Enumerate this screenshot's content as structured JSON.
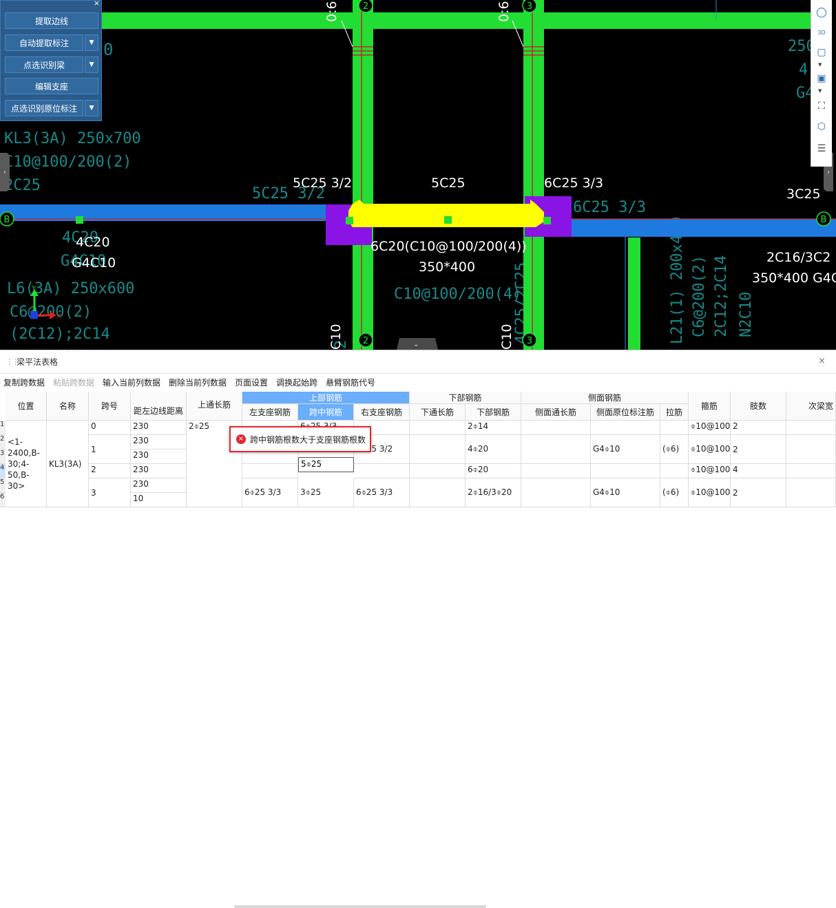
{
  "toolbar": {
    "close": "×",
    "extract_edge": "提取边线",
    "auto_extract_label": "自动提取标注",
    "pick_identify_beam": "点选识别梁",
    "edit_support": "编辑支座",
    "pick_identify_inplace": "点选识别原位标注",
    "dropdown_arrow": "▼"
  },
  "cad": {
    "axis_top_2": "2",
    "axis_top_3": "3",
    "axis_bottom_2": "2",
    "axis_bottom_3": "3",
    "axis_b_left": "B",
    "axis_b_right": "B",
    "top_left_dim_a": "0:6",
    "top_left_dim_b": "0:6",
    "kl3_name": "KL3(3A) 250x700",
    "kl3_stirrup": "C10@100/200(2)",
    "kl3_bottom": "2C25",
    "l6_name": "L6(3A) 250x600",
    "l6_stirrup": "C6@200(2)",
    "l6_bottom": "(2C12);2C14",
    "label_5c25_32": "5C25 3/2",
    "label_5c25": "5C25",
    "label_6c25_33": "6C25 3/3",
    "label_3c25": "3C25",
    "label_4c20": "4C20",
    "label_g4c10": "G4C10",
    "label_6c20": "6C20(C10@100/200(4))",
    "label_350x400": "350*400",
    "label_2c16": "2C16/3C2",
    "label_350x400_g4": "350*400 G4C",
    "teal_5c25_32": "5C25 3/2",
    "teal_5c25_vert": "5C25 3/2",
    "teal_6c25_33": "6C25 3/3",
    "teal_4c20": "4C20",
    "teal_g4c10": "G4C10",
    "teal_c10": "C10@100/200(4)",
    "teal_4c25": "4C25/2C25",
    "teal_l21": "L21(1) 200x400",
    "teal_c6": "C6@200(2)",
    "teal_2c12": "2C12;2C14",
    "teal_n2c10": "N2C10",
    "teal_250": "250",
    "teal_4": "4",
    "teal_g4": "G4",
    "teal_c10_left": "C10",
    "teal_c10_right": "C10",
    "axis_x": "X",
    "axis_y": "Y"
  },
  "panel": {
    "title": "梁平法表格",
    "close": "×",
    "menu": [
      "复制跨数据",
      "粘贴跨数据",
      "输入当前列数据",
      "删除当前列数据",
      "页面设置",
      "调换起始跨",
      "悬臂钢筋代号"
    ]
  },
  "table": {
    "headers": {
      "position": "位置",
      "name": "名称",
      "span": "跨号",
      "dist_left": "距左边线距离",
      "top_through": "上通长筋",
      "top_group": "上部钢筋",
      "left_support": "左支座钢筋",
      "mid_span": "跨中钢筋",
      "right_support": "右支座钢筋",
      "bottom_group": "下部钢筋",
      "bottom_through": "下通长筋",
      "bottom_bar": "下部钢筋",
      "side_group": "侧面钢筋",
      "side_through": "侧面通长筋",
      "side_inplace": "侧面原位标注筋",
      "tie": "拉筋",
      "stirrup": "箍筋",
      "legs": "肢数",
      "secondary": "次梁宽"
    },
    "position": "<1-2400,B-30;4-50,B-30>",
    "name": "KL3(3A)",
    "top_through": "2⌽25",
    "row_numbers": [
      "1",
      "2",
      "3",
      "4",
      "5",
      "6"
    ],
    "spans": [
      {
        "no": "0",
        "dist": [
          "230"
        ],
        "left": "",
        "mid": "6⌽25 3/3",
        "right": "",
        "bot_through": "",
        "bottom": "2⌽14",
        "side_through": "",
        "side_inplace": "",
        "tie": "",
        "stirrup": "⌽10@100",
        "legs": "2"
      },
      {
        "no": "1",
        "dist": [
          "230",
          "230"
        ],
        "left": "",
        "mid": "",
        "right": "5⌽25 3/2",
        "bot_through": "",
        "bottom": "4⌽20",
        "side_through": "",
        "side_inplace": "G4⌽10",
        "tie": "(⌽6)",
        "stirrup": "⌽10@100",
        "legs": "2"
      },
      {
        "no": "2",
        "dist": [
          "230"
        ],
        "left": "",
        "mid": "5⌽25",
        "right": "",
        "bot_through": "",
        "bottom": "6⌽20",
        "side_through": "",
        "side_inplace": "",
        "tie": "",
        "stirrup": "⌽10@100",
        "legs": "4"
      },
      {
        "no": "3",
        "dist": [
          "230",
          "10"
        ],
        "left": "6⌽25 3/3",
        "mid": "3⌽25",
        "right": "6⌽25 3/3",
        "bot_through": "",
        "bottom": "2⌽16/3⌽20",
        "side_through": "",
        "side_inplace": "G4⌽10",
        "tie": "(⌽6)",
        "stirrup": "⌽10@100",
        "legs": "2"
      }
    ]
  },
  "tooltip": {
    "icon": "×",
    "message": "跨中钢筋根数大于支座钢筋根数"
  },
  "colors": {
    "beam_green": "#22dd33",
    "beam_blue": "#1f7ae0",
    "highlight_yellow": "#ffff00",
    "support_purple": "#8a13e6",
    "header_blue": "#6aaefc",
    "error_red": "#e0282e"
  }
}
